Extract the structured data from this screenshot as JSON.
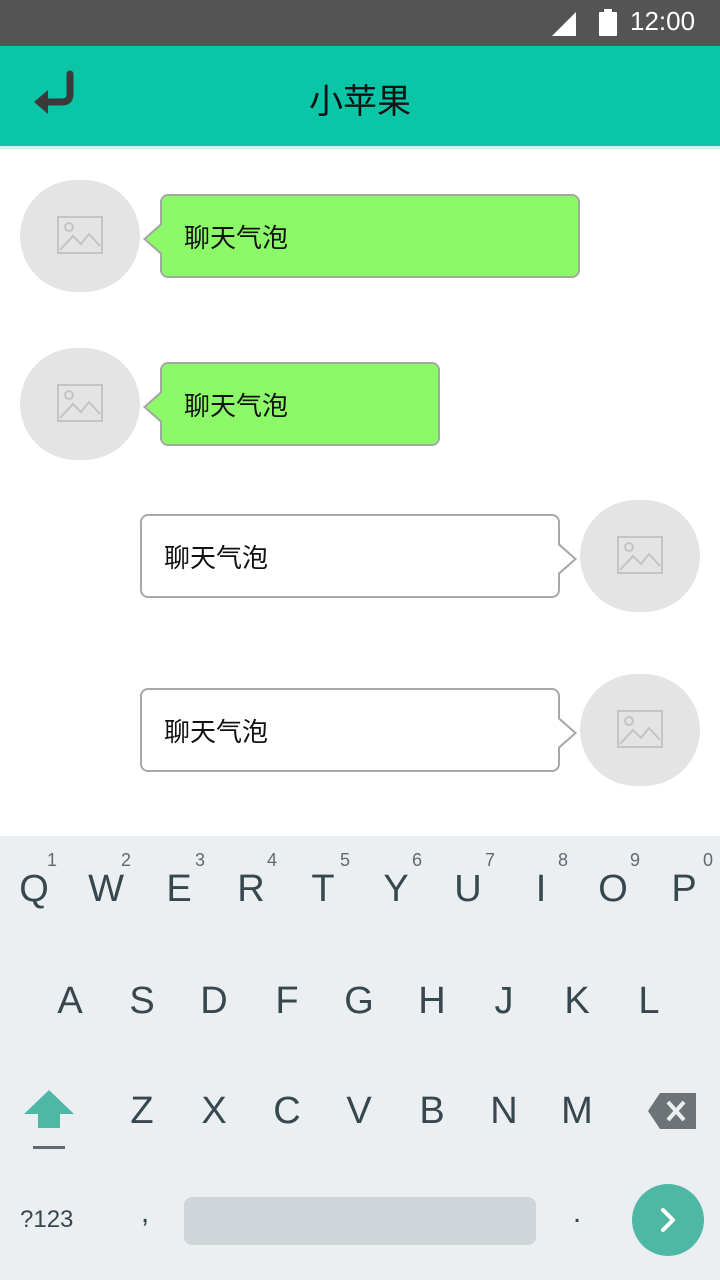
{
  "status_bar": {
    "time": "12:00"
  },
  "app_bar": {
    "title": "小苹果",
    "accent_color": "#0bc5a7"
  },
  "messages": [
    {
      "side": "received",
      "text": "聊天气泡"
    },
    {
      "side": "received",
      "text": "聊天气泡"
    },
    {
      "side": "sent",
      "text": "聊天气泡"
    },
    {
      "side": "sent",
      "text": "聊天气泡"
    }
  ],
  "bubble_colors": {
    "received": "#8cfa68",
    "sent": "#ffffff"
  },
  "keyboard": {
    "row1": [
      {
        "key": "Q",
        "hint": "1"
      },
      {
        "key": "W",
        "hint": "2"
      },
      {
        "key": "E",
        "hint": "3"
      },
      {
        "key": "R",
        "hint": "4"
      },
      {
        "key": "T",
        "hint": "5"
      },
      {
        "key": "Y",
        "hint": "6"
      },
      {
        "key": "U",
        "hint": "7"
      },
      {
        "key": "I",
        "hint": "8"
      },
      {
        "key": "O",
        "hint": "9"
      },
      {
        "key": "P",
        "hint": "0"
      }
    ],
    "row2": [
      "A",
      "S",
      "D",
      "F",
      "G",
      "H",
      "J",
      "K",
      "L"
    ],
    "row3": [
      "Z",
      "X",
      "C",
      "V",
      "B",
      "N",
      "M"
    ],
    "symbols_label": "?123",
    "comma": ",",
    "period": ".",
    "icons": {
      "shift": "shift-arrow-icon",
      "backspace": "backspace-icon",
      "enter": "chevron-right-icon",
      "back": "back-arrow-icon",
      "avatar": "image-placeholder-icon"
    }
  }
}
